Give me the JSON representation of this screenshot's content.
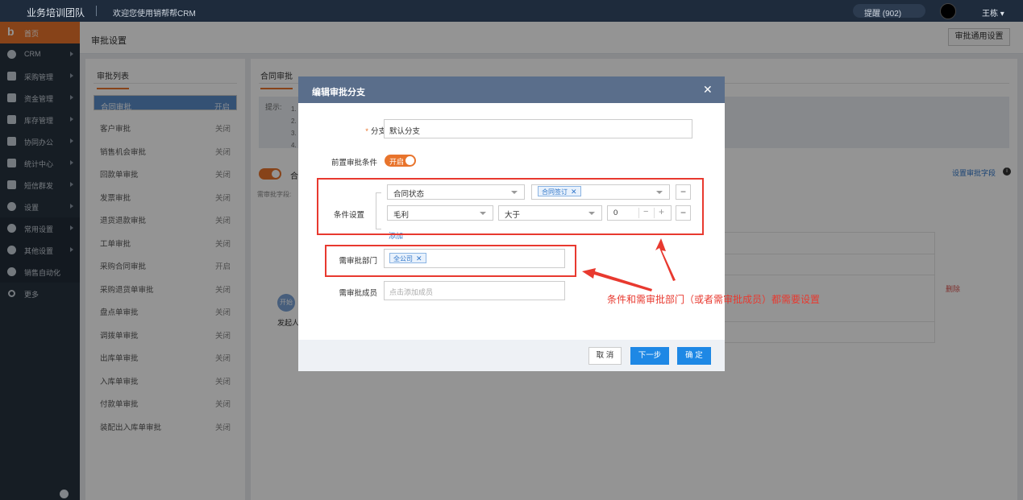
{
  "topbar": {
    "brand": "业务培训团队",
    "welcome": "欢迎您使用销帮帮CRM",
    "remind": "提醒 (902)",
    "user": "王栋 ▾"
  },
  "sidebar": {
    "items": [
      {
        "label": "首页",
        "icon": "home-logo-icon"
      },
      {
        "label": "CRM",
        "icon": "crm-icon"
      },
      {
        "label": "采购管理",
        "icon": "purchase-icon"
      },
      {
        "label": "资金管理",
        "icon": "finance-icon"
      },
      {
        "label": "库存管理",
        "icon": "inventory-icon"
      },
      {
        "label": "协同办公",
        "icon": "office-icon"
      },
      {
        "label": "统计中心",
        "icon": "stats-icon"
      },
      {
        "label": "短信群发",
        "icon": "sms-icon"
      },
      {
        "label": "设置",
        "icon": "settings-icon"
      },
      {
        "label": "常用设置",
        "icon": "gear-icon"
      },
      {
        "label": "其他设置",
        "icon": "gear-icon"
      },
      {
        "label": "销售自动化",
        "icon": "automation-icon"
      },
      {
        "label": "更多",
        "icon": "more-icon"
      }
    ]
  },
  "header": {
    "title": "审批设置",
    "general_button": "审批通用设置"
  },
  "left_panel": {
    "title": "审批列表",
    "rows": [
      {
        "name": "合同审批",
        "status": "开启"
      },
      {
        "name": "客户审批",
        "status": "关闭"
      },
      {
        "name": "销售机会审批",
        "status": "关闭"
      },
      {
        "name": "回款单审批",
        "status": "关闭"
      },
      {
        "name": "发票审批",
        "status": "关闭"
      },
      {
        "name": "退货退款审批",
        "status": "关闭"
      },
      {
        "name": "工单审批",
        "status": "关闭"
      },
      {
        "name": "采购合同审批",
        "status": "开启"
      },
      {
        "name": "采购退货单审批",
        "status": "关闭"
      },
      {
        "name": "盘点单审批",
        "status": "关闭"
      },
      {
        "name": "调拨单审批",
        "status": "关闭"
      },
      {
        "name": "出库单审批",
        "status": "关闭"
      },
      {
        "name": "入库单审批",
        "status": "关闭"
      },
      {
        "name": "付款单审批",
        "status": "关闭"
      },
      {
        "name": "装配出入库单审批",
        "status": "关闭"
      }
    ]
  },
  "right_panel": {
    "tab": "合同审批",
    "tip_label": "提示:",
    "tip_numbers": [
      "1.",
      "2.",
      "3.",
      "4."
    ],
    "toggle_label": "合",
    "field_label": "需审批字段:",
    "set_field": "设置审批字段",
    "delete": "删除",
    "start_node": "开始",
    "initiator": "发起人"
  },
  "modal": {
    "title": "编辑审批分支",
    "branch_name_label": "分支名称",
    "branch_name_value": "默认分支",
    "precondition_label": "前置审批条件",
    "precondition_toggle": "开启",
    "condition_label": "条件设置",
    "cond1_field": "合同状态",
    "cond1_tag": "合同签订",
    "cond2_field": "毛利",
    "cond2_op": "大于",
    "cond2_value": "0",
    "add_link": "添加",
    "dept_label": "需审批部门",
    "dept_tag": "全公司",
    "member_label": "需审批成员",
    "member_placeholder": "点击添加成员",
    "cancel": "取 消",
    "next": "下一步",
    "confirm": "确 定"
  },
  "annotation": "条件和需审批部门（或者需审批成员）都需要设置",
  "colors": {
    "accent": "#e8742c",
    "primary": "#1e88e5",
    "annotation_red": "#e8392f"
  }
}
